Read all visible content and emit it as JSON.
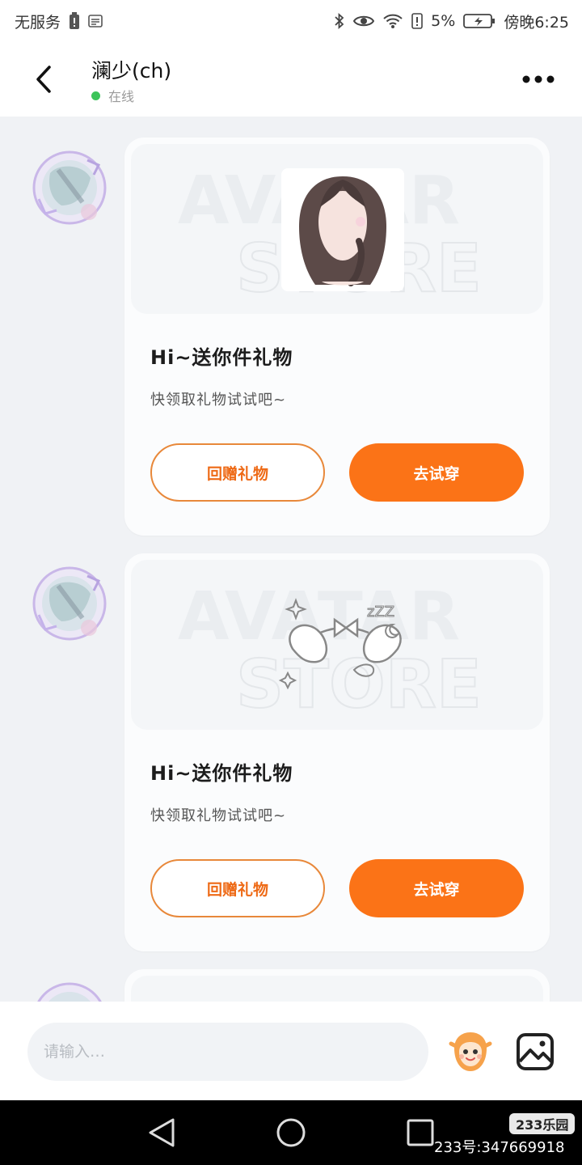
{
  "status_bar": {
    "carrier": "无服务",
    "battery_percent": "5%",
    "time": "傍晚6:25"
  },
  "header": {
    "title": "澜少(ch)",
    "presence": "在线",
    "presence_color": "#3dc45a"
  },
  "messages": [
    {
      "card_title": "Hi~送你件礼物",
      "card_subtitle": "快领取礼物试试吧~",
      "return_gift_label": "回赠礼物",
      "try_on_label": "去试穿",
      "watermark_line1": "AVATAR",
      "watermark_line2": "STORE",
      "gift_image": "hairstyle-icon"
    },
    {
      "card_title": "Hi~送你件礼物",
      "card_subtitle": "快领取礼物试试吧~",
      "return_gift_label": "回赠礼物",
      "try_on_label": "去试穿",
      "watermark_line1": "AVATAR",
      "watermark_line2": "STORE",
      "gift_image": "sleep-mask-icon"
    }
  ],
  "input_bar": {
    "placeholder": "请输入…"
  },
  "nav_bar": {
    "brand": "233乐园",
    "account_id": "233号:347669918"
  },
  "colors": {
    "accent": "#fb7317",
    "accent_outline": "#e8883a",
    "background": "#f0f2f5"
  }
}
